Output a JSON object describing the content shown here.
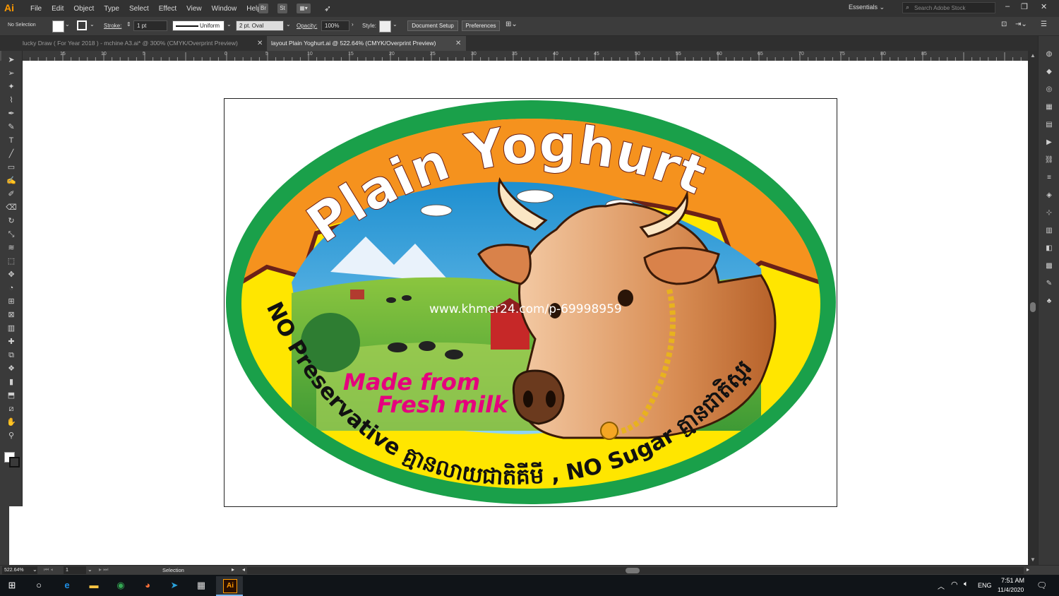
{
  "app": {
    "logo": "Ai"
  },
  "menu": [
    "File",
    "Edit",
    "Object",
    "Type",
    "Select",
    "Effect",
    "View",
    "Window",
    "Help"
  ],
  "menubar_icons": [
    "bridge-icon",
    "stock-icon",
    "arrange-documents-icon",
    "gpu-rocket-icon"
  ],
  "workspace": {
    "label": "Essentials",
    "search_placeholder": "Search Adobe Stock"
  },
  "window_controls": [
    "minimize-icon",
    "restore-icon",
    "close-icon"
  ],
  "control_bar": {
    "selection": "No Selection",
    "stroke_label": "Stroke:",
    "stroke_weight": "1 pt",
    "stroke_profile": "Uniform",
    "brush": "2 pt. Oval",
    "opacity_label": "Opacity:",
    "opacity_value": "100%",
    "style_label": "Style:",
    "document_setup": "Document Setup",
    "preferences": "Preferences"
  },
  "tabs": [
    {
      "title": "lucky Draw ( For Year 2018 ) - mchine A3.ai* @ 300% (CMYK/Overprint Preview)",
      "active": false
    },
    {
      "title": "layout Plain Yoghurt.ai @ 522.64% (CMYK/Overprint Preview)",
      "active": true
    }
  ],
  "ruler": {
    "marks": [
      "15",
      "10",
      "5",
      "0",
      "5",
      "10",
      "15",
      "20",
      "25",
      "30",
      "35",
      "40",
      "45",
      "50",
      "55",
      "60",
      "65",
      "70",
      "75",
      "80",
      "85"
    ]
  },
  "tools": [
    "selection-tool-icon",
    "direct-selection-tool-icon",
    "magic-wand-tool-icon",
    "lasso-tool-icon",
    "pen-tool-icon",
    "curvature-tool-icon",
    "type-tool-icon",
    "line-tool-icon",
    "rectangle-tool-icon",
    "paintbrush-tool-icon",
    "shaper-tool-icon",
    "eraser-tool-icon",
    "rotate-tool-icon",
    "scale-tool-icon",
    "warp-tool-icon",
    "free-transform-tool-icon",
    "puppet-warp-tool-icon",
    "shape-builder-tool-icon",
    "perspective-grid-tool-icon",
    "mesh-tool-icon",
    "gradient-tool-icon",
    "eyedropper-tool-icon",
    "blend-tool-icon",
    "symbol-sprayer-tool-icon",
    "column-graph-tool-icon",
    "artboard-tool-icon",
    "slice-tool-icon",
    "hand-tool-icon",
    "zoom-tool-icon"
  ],
  "right_panel_icons": [
    "color-panel-icon",
    "libraries-panel-icon",
    "appearance-panel-icon",
    "color-guide-panel-icon",
    "gradient-panel-icon",
    "actions-panel-icon",
    "links-panel-icon",
    "stroke-panel-icon",
    "layers-panel-icon",
    "transform-panel-icon",
    "align-panel-icon",
    "pathfinder-panel-icon",
    "image-trace-panel-icon",
    "brushes-panel-icon",
    "symbols-panel-icon"
  ],
  "artwork": {
    "title": "Plain Yoghurt",
    "watermark": "www.khmer24.com/p-69998959",
    "tagline_line1": "Made from",
    "tagline_line2": "Fresh milk",
    "bottom_text": "NO Preservative  គ្មានលាយជាតិគីមី , NO Sugar  គ្មានជាតិស្ករ",
    "colors": {
      "outer_ring": "#1aa04a",
      "banner": "#f5921e",
      "banner_edge": "#6b2118",
      "yellow_band": "#ffe600",
      "tagline": "#e5007e",
      "sky": "#2aa7e0",
      "grass": "#6ab843"
    }
  },
  "status": {
    "zoom": "522.64%",
    "artboard_number": "1",
    "tool": "Selection"
  },
  "taskbar": {
    "apps": [
      "windows-start-icon",
      "cortana-search-icon",
      "edge-icon",
      "file-explorer-icon",
      "chrome-icon",
      "firefox-icon",
      "telegram-icon",
      "calculator-icon",
      "illustrator-icon"
    ],
    "language": "ENG",
    "time": "7:51 AM",
    "date": "11/4/2020"
  }
}
